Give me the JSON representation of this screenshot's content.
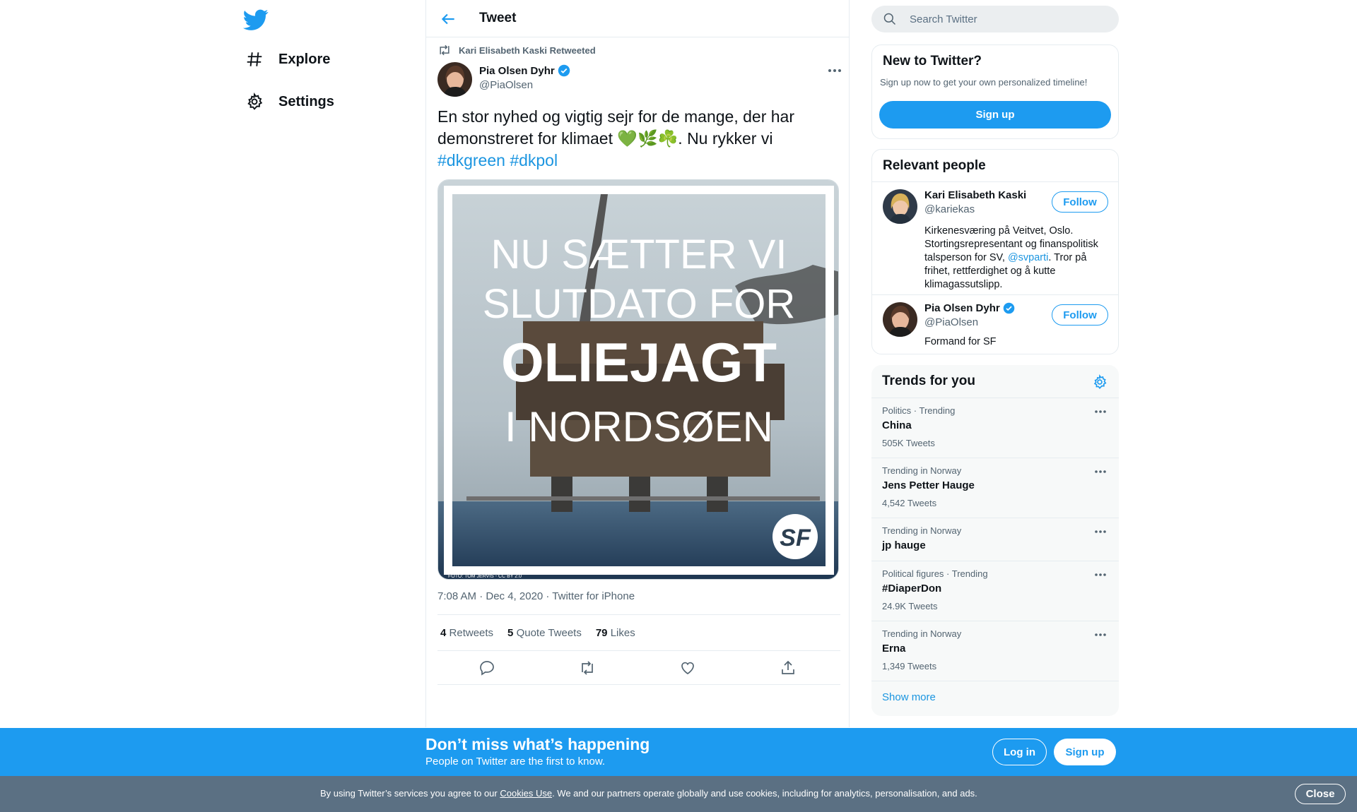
{
  "nav": {
    "items": [
      {
        "label": "Explore",
        "icon": "hashtag-icon"
      },
      {
        "label": "Settings",
        "icon": "gear-icon"
      }
    ]
  },
  "header": {
    "title": "Tweet"
  },
  "tweet": {
    "retweeted_by": "Kari Elisabeth Kaski Retweeted",
    "author_name": "Pia Olsen Dyhr",
    "author_handle": "@PiaOlsen",
    "text_part1": "En stor nyhed og vigtig sejr for de mange, der har demonstreret for klimaet 💚🌿☘️. Nu rykker vi",
    "hashtag1": "#dkgreen",
    "hashtag2": "#dkpol",
    "image_lines": [
      "NU SÆTTER VI",
      "SLUTDATO FOR",
      "OLIEJAGT",
      "I NORDSØEN"
    ],
    "image_logo": "SF",
    "image_credit": "FOTO: TOM JERVIS - CC BY 2.0",
    "timestamp": "7:08 AM · Dec 4, 2020 · Twitter for iPhone",
    "retweets_count": "4",
    "retweets_label": "Retweets",
    "quotes_count": "5",
    "quotes_label": "Quote Tweets",
    "likes_count": "79",
    "likes_label": "Likes"
  },
  "search": {
    "placeholder": "Search Twitter"
  },
  "new_to_twitter": {
    "title": "New to Twitter?",
    "subtitle": "Sign up now to get your own personalized timeline!",
    "button": "Sign up"
  },
  "relevant_people": {
    "title": "Relevant people",
    "people": [
      {
        "name": "Kari Elisabeth Kaski",
        "handle": "@kariekas",
        "bio_before": "Kirkenesværing på Veitvet, Oslo. Stortingsrepresentant og finanspolitisk talsperson for SV, ",
        "bio_link": "@svparti",
        "bio_after": ". Tror på frihet, rettferdighet og å kutte klimagassutslipp.",
        "follow": "Follow"
      },
      {
        "name": "Pia Olsen Dyhr",
        "handle": "@PiaOlsen",
        "bio": "Formand for SF",
        "follow": "Follow"
      }
    ]
  },
  "trends": {
    "title": "Trends for you",
    "items": [
      {
        "context": "Politics · Trending",
        "name": "China",
        "count": "505K Tweets"
      },
      {
        "context": "Trending in Norway",
        "name": "Jens Petter Hauge",
        "count": "4,542 Tweets"
      },
      {
        "context": "Trending in Norway",
        "name": "jp hauge",
        "count": ""
      },
      {
        "context": "Political figures · Trending",
        "name": "#DiaperDon",
        "count": "24.9K Tweets"
      },
      {
        "context": "Trending in Norway",
        "name": "Erna",
        "count": "1,349 Tweets"
      }
    ],
    "show_more": "Show more"
  },
  "banner": {
    "title": "Don’t miss what’s happening",
    "subtitle": "People on Twitter are the first to know.",
    "login": "Log in",
    "signup": "Sign up"
  },
  "cookie": {
    "before": "By using Twitter’s services you agree to our ",
    "link": "Cookies Use",
    "after": ". We and our partners operate globally and use cookies, including for analytics, personalisation, and ads.",
    "close": "Close"
  },
  "colors": {
    "accent": "#1d9bf0",
    "link": "#1b95e0",
    "cookie_bar": "#5b7083",
    "verified": "#1d9bf0"
  }
}
